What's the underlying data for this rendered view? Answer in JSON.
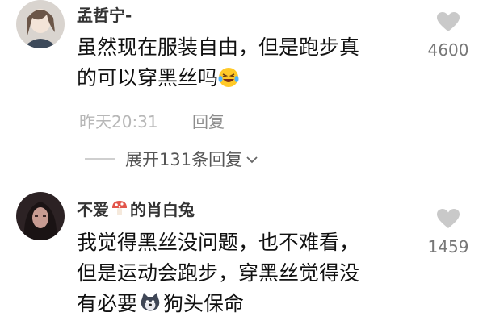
{
  "comments": [
    {
      "username": "孟哲宁-",
      "content_lines": [
        "虽然现在服装自由，但是跑步真",
        "的可以穿黑丝吗"
      ],
      "emoji": "laughing-tears-emoji",
      "time": "昨天20:31",
      "reply_label": "回复",
      "likes": "4600",
      "expand_label": "展开131条回复"
    },
    {
      "username_prefix": "不爱",
      "username_icon": "mushroom-icon",
      "username_suffix": "的肖白兔",
      "content_lines": [
        "我觉得黑丝没问题，也不难看，",
        "但是运动会跑步，穿黑丝觉得没"
      ],
      "line3_before": "有必要",
      "inline_icon": "doge-icon",
      "line3_after": "狗头保命",
      "likes": "1459"
    }
  ],
  "colors": {
    "like_icon": "#c9c9c9",
    "mushroom": "#e2554a"
  }
}
